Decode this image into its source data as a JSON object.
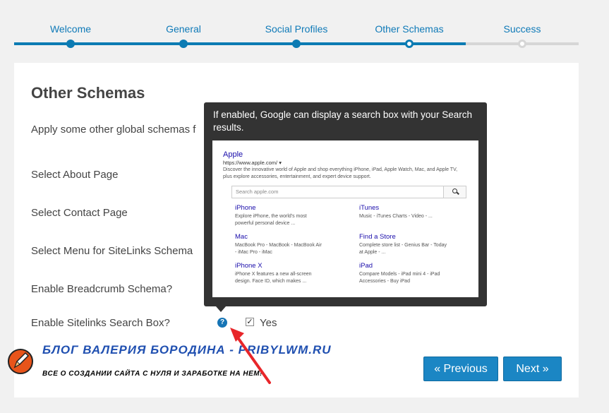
{
  "steps": [
    {
      "label": "Welcome",
      "state": "done"
    },
    {
      "label": "General",
      "state": "done"
    },
    {
      "label": "Social Profiles",
      "state": "done"
    },
    {
      "label": "Other Schemas",
      "state": "current"
    },
    {
      "label": "Success",
      "state": "todo"
    }
  ],
  "card": {
    "title": "Other Schemas",
    "description": "Apply some other global schemas f",
    "rows": [
      "Select About Page",
      "Select Contact Page",
      "Select Menu for SiteLinks Schema",
      "Enable Breadcrumb Schema?",
      "Enable Sitelinks Search Box?"
    ],
    "help_icon_glyph": "?",
    "checkbox_checked": true,
    "checkbox_label": "Yes",
    "prev_button": "« Previous",
    "next_button": "Next »"
  },
  "tooltip": {
    "text": "If enabled, Google can display a search box with your Search results.",
    "preview": {
      "title": "Apple",
      "url": "https://www.apple.com/ ▾",
      "description": "Discover the innovative world of Apple and shop everything iPhone, iPad, Apple Watch, Mac, and Apple TV, plus explore accessories, entertainment, and expert device support.",
      "search_placeholder": "Search apple.com",
      "links": [
        {
          "title": "iPhone",
          "desc": "Explore iPhone, the world's most powerful personal device ..."
        },
        {
          "title": "iTunes",
          "desc": "Music - iTunes Charts - Video - ..."
        },
        {
          "title": "Mac",
          "desc": "MacBook Pro - MacBook - MacBook Air - iMac Pro - iMac"
        },
        {
          "title": "Find a Store",
          "desc": "Complete store list - Genius Bar - Today at Apple - ..."
        },
        {
          "title": "iPhone X",
          "desc": "iPhone X features a new all-screen design. Face ID, which makes ..."
        },
        {
          "title": "iPad",
          "desc": "Compare Models - iPad mini 4 - iPad Accessories - Buy iPad"
        }
      ]
    }
  },
  "overlay": {
    "title": "БЛОГ ВАЛЕРИЯ БОРОДИНА - PRIBYLWM.RU",
    "subtitle": "ВСЕ О СОЗДАНИИ САЙТА С НУЛЯ И ЗАРАБОТКЕ НА НЕМ!"
  },
  "colors": {
    "accent": "#0c7bb3",
    "button": "#1b86c4",
    "tooltip_bg": "#333333",
    "arrow": "#e8262a"
  }
}
